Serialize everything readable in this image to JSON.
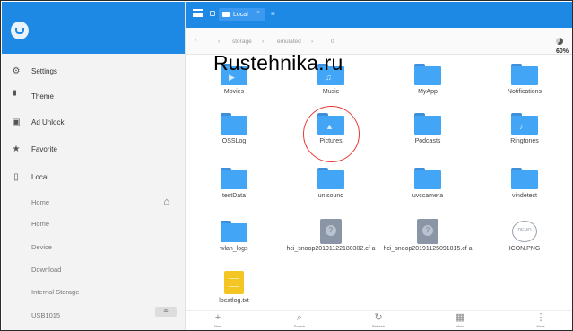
{
  "watermark": "Rustehnika.ru",
  "topbar": {
    "tab_label": "Local",
    "tab_add": "≡"
  },
  "breadcrumb": {
    "root": "/",
    "items": [
      "storage",
      "emulated",
      "0"
    ],
    "storage_percent": "60%"
  },
  "sidebar": {
    "items": [
      {
        "label": "Settings"
      },
      {
        "label": "Theme"
      },
      {
        "label": "Ad Unlock"
      },
      {
        "label": "Favorite"
      },
      {
        "label": "Local"
      }
    ],
    "sub_items": [
      {
        "label": "Home"
      },
      {
        "label": "Home"
      },
      {
        "label": "Device"
      },
      {
        "label": "Download"
      },
      {
        "label": "Internal Storage"
      },
      {
        "label": "USB1015"
      }
    ]
  },
  "files": [
    {
      "name": "Movies"
    },
    {
      "name": "Music"
    },
    {
      "name": "MyApp"
    },
    {
      "name": "Notifications"
    },
    {
      "name": "OSSLog"
    },
    {
      "name": "Pictures"
    },
    {
      "name": "Podcasts"
    },
    {
      "name": "Ringtones"
    },
    {
      "name": "testData"
    },
    {
      "name": "unisound"
    },
    {
      "name": "uvccamera"
    },
    {
      "name": "vindetect"
    },
    {
      "name": "wlan_logs"
    },
    {
      "name": "hci_snoop20191122180302.cf a"
    },
    {
      "name": "hci_snoop20191125091815.cf a"
    },
    {
      "name": "ICON.PNG",
      "badge": "DEMO"
    },
    {
      "name": "locatlog.txt"
    }
  ],
  "bottombar": [
    {
      "icon": "+",
      "label": "New"
    },
    {
      "icon": "⌕",
      "label": "Search"
    },
    {
      "icon": "↻",
      "label": "Refresh"
    },
    {
      "icon": "▦",
      "label": "View"
    },
    {
      "icon": "⋮",
      "label": "More"
    }
  ],
  "colors": {
    "accent": "#1e88e5",
    "folder": "#42a5f5",
    "highlight_circle": "#e53935"
  }
}
